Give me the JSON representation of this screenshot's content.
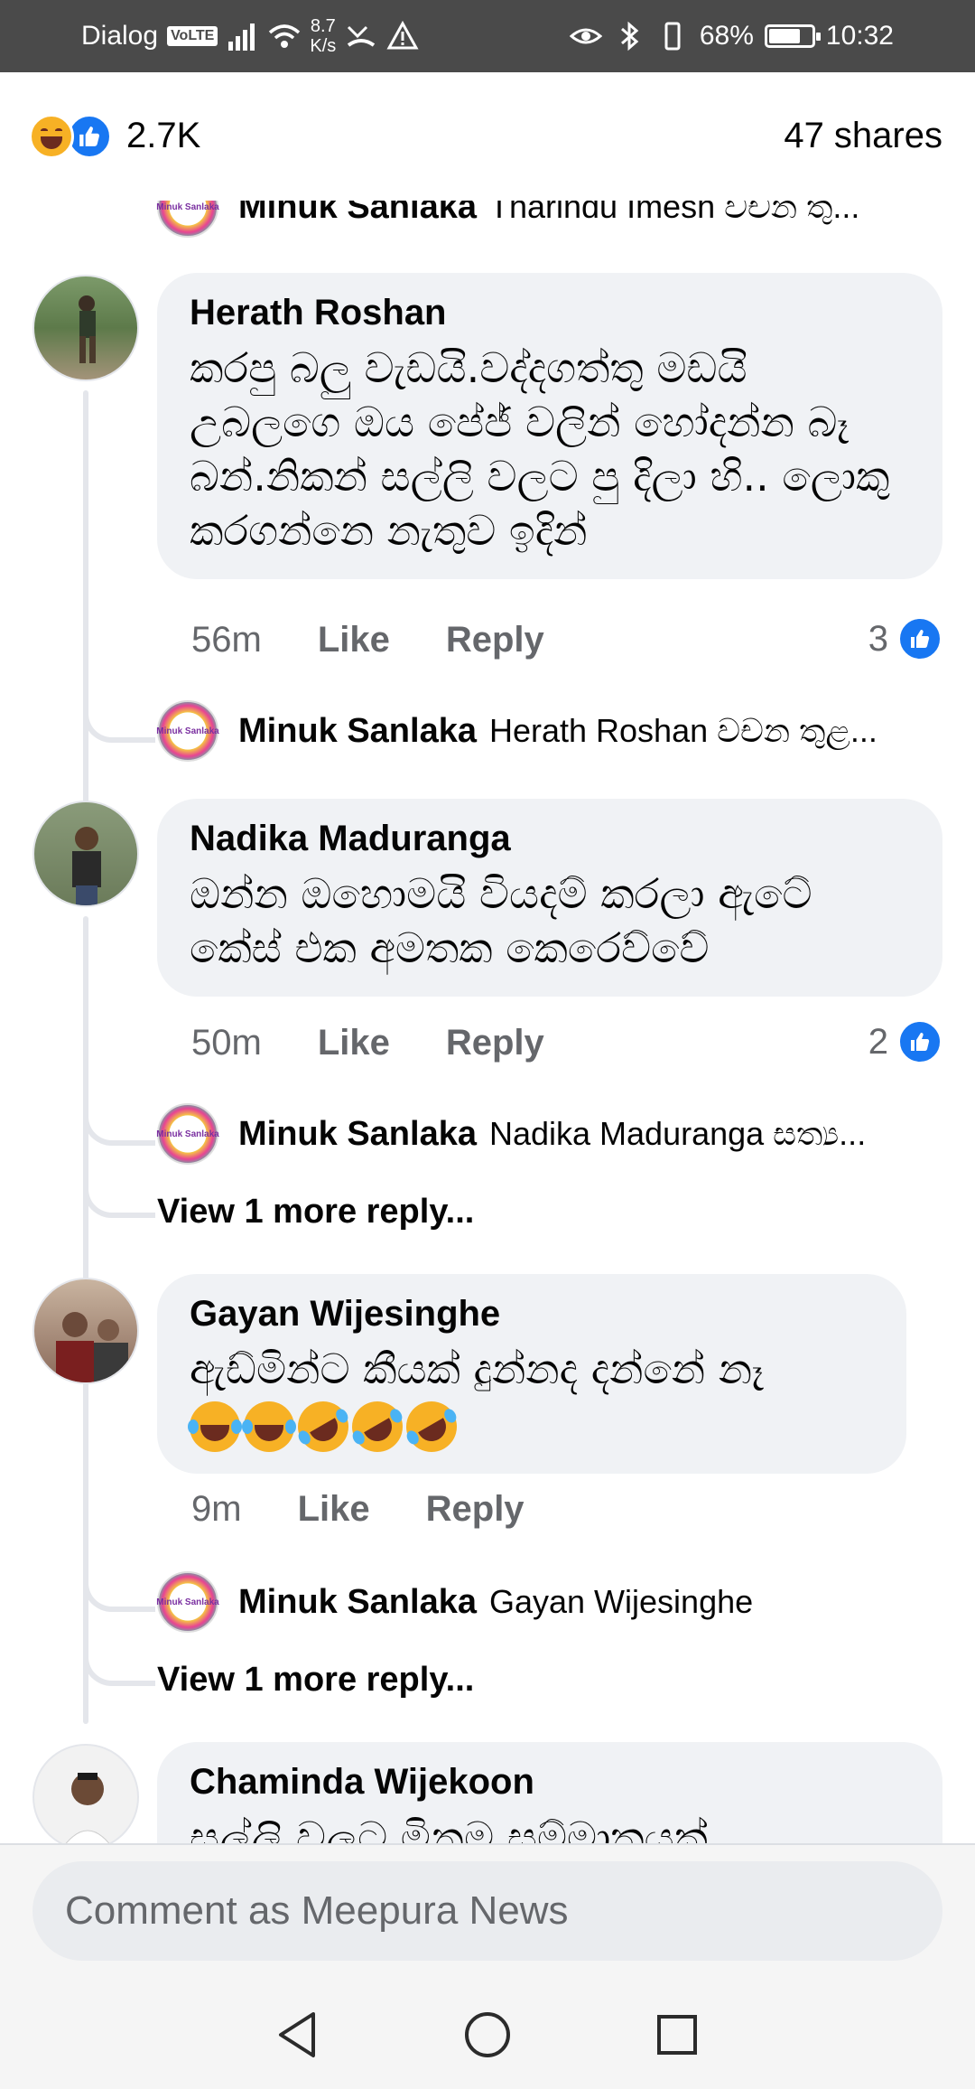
{
  "status_bar": {
    "carrier": "Dialog",
    "volte": "VoLTE",
    "net_speed_value": "8.7",
    "net_speed_unit": "K/s",
    "battery": "68%",
    "time": "10:32"
  },
  "post_stats": {
    "reaction_icons": [
      "haha-icon",
      "like-icon"
    ],
    "reaction_count": "2.7K",
    "shares": "47 shares"
  },
  "comments": [
    {
      "author": "Herath Roshan",
      "text": "කරපු බලු වැඩයි.වද්දගත්තු මඩයි උබලගෙ ඔය පේජ් වලින් හෝදන්න බෑ බන්.නිකන් සල්ලි වලට පු  දිලා හි.. ලොකු කරගන්නෙ නැතුව ඉදින්",
      "time": "56m",
      "like_label": "Like",
      "reply_label": "Reply",
      "reaction_count": "3",
      "reply_preview": {
        "author": "Minuk Sanlaka",
        "text": "Herath Roshan වචන තුළ..."
      }
    },
    {
      "author": "Nadika Maduranga",
      "text": "ඔන්න ඔහොමයි වියදම් කරලා ඇටේ කේස් එක අමතක කෙරෙව්වේ",
      "time": "50m",
      "like_label": "Like",
      "reply_label": "Reply",
      "reaction_count": "2",
      "reply_preview": {
        "author": "Minuk Sanlaka",
        "text": "Nadika Maduranga සත්‍ය..."
      },
      "view_more": "View 1 more reply..."
    },
    {
      "author": "Gayan Wijesinghe",
      "text": "ඇඩ්මින්ට කීයක් දුන්නද දන්නේ නෑ",
      "emojis": [
        "joy-icon",
        "joy-icon",
        "rofl-icon",
        "rofl-icon",
        "rofl-icon"
      ],
      "time": "9m",
      "like_label": "Like",
      "reply_label": "Reply",
      "reply_preview": {
        "author": "Minuk Sanlaka",
        "text": "Gayan Wijesinghe"
      },
      "view_more": "View 1 more reply..."
    },
    {
      "author": "Chaminda Wijekoon",
      "text": "සල්ලි වලට මිනුම සම්මාතයක්"
    }
  ],
  "previous_reply": {
    "author": "Minuk Sanlaka",
    "text": "Tharindu Imesh වචන තු..."
  },
  "mini_avatar_text": "Minuk Sanlaka",
  "composer": {
    "placeholder": "Comment as Meepura News"
  },
  "colors": {
    "accent": "#1877f2",
    "bubble": "#f0f2f5",
    "status_bar": "#4a4a4a"
  }
}
